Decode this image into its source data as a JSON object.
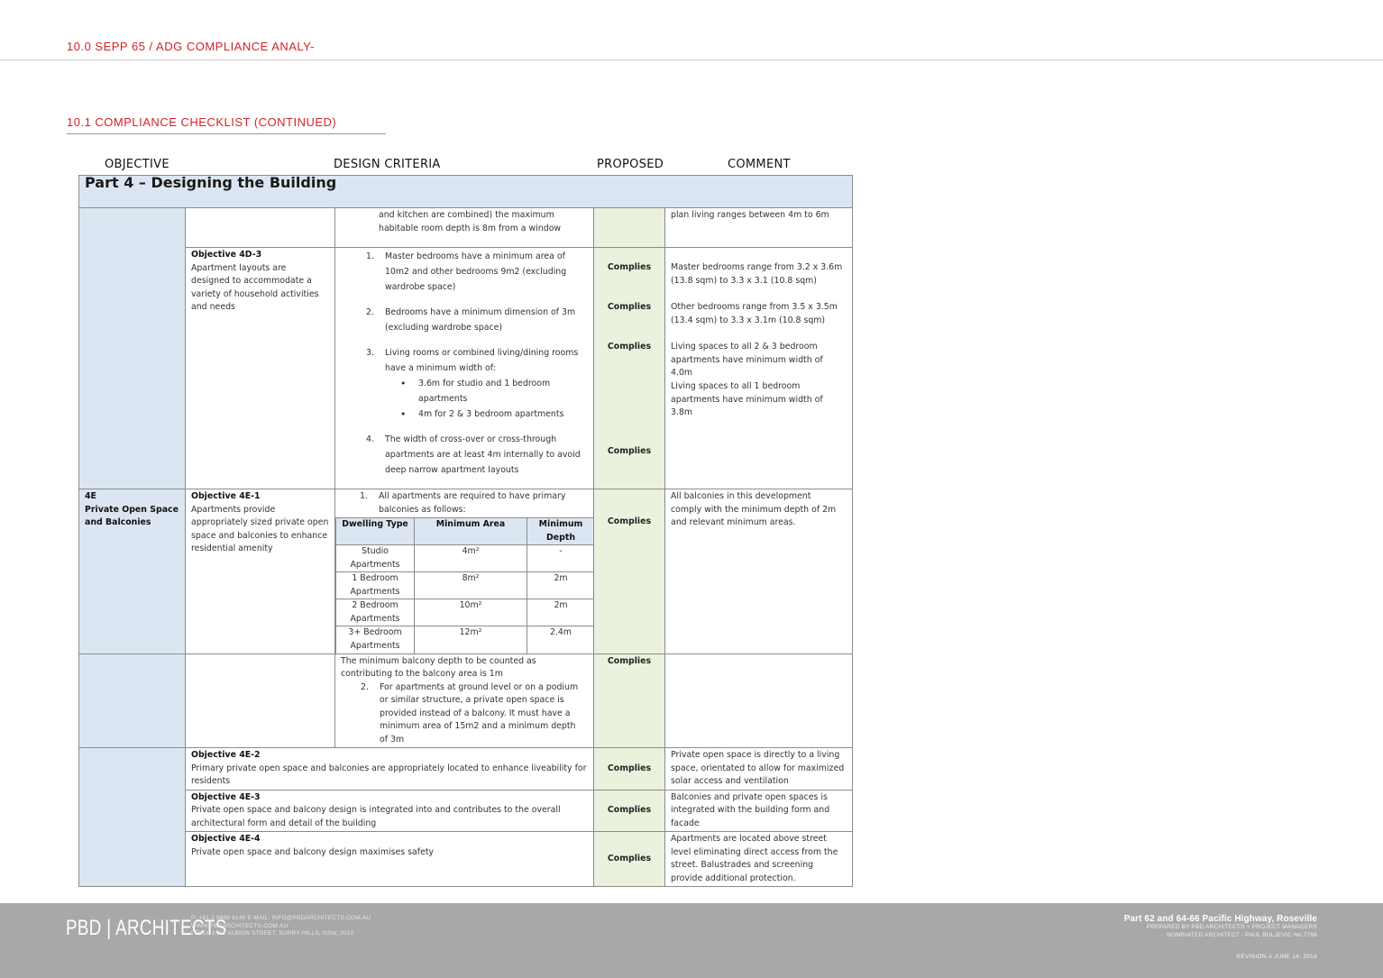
{
  "header": {
    "title": "10.0 SEPP 65 / ADG COMPLIANCE ANALY-"
  },
  "section": {
    "title": "10.1 COMPLIANCE CHECKLIST (CONTINUED)"
  },
  "columns": {
    "objective": "OBJECTIVE",
    "design_criteria": "DESIGN CRITERIA",
    "proposed": "PROPOSED",
    "comment": "COMMENT"
  },
  "part": {
    "title": "Part 4 – Designing the Building"
  },
  "rows": {
    "cont": {
      "criteria": "and kitchen are combined) the maximum habitable room depth is 8m from a window",
      "comment": "plan living ranges between 4m to 6m"
    },
    "o4d3": {
      "title": "Objective 4D-3",
      "desc": "Apartment layouts are designed to accommodate a variety of household activities and needs",
      "items": [
        {
          "num": "1.",
          "text": "Master bedrooms have a minimum area of 10m2 and other bedrooms 9m2 (excluding wardrobe space)",
          "proposed": "Complies",
          "comment": "Master bedrooms range from 3.2 x 3.6m (13.8 sqm) to 3.3 x 3.1 (10.8 sqm)"
        },
        {
          "num": "2.",
          "text": "Bedrooms have a minimum dimension of 3m (excluding wardrobe space)",
          "proposed": "Complies",
          "comment": "Other bedrooms range from 3.5 x 3.5m (13.4 sqm) to 3.3 x 3.1m (10.8 sqm)"
        },
        {
          "num": "3.",
          "text": "Living rooms or combined living/dining rooms have a minimum width of:",
          "sub": [
            "3.6m for studio and 1 bedroom apartments",
            "4m for 2 & 3 bedroom apartments"
          ],
          "proposed": "Complies",
          "comment": "Living spaces to all 2 & 3 bedroom apartments have minimum width of 4.0m",
          "comment2": "Living spaces to all 1 bedroom apartments have minimum width of 3.8m"
        },
        {
          "num": "4.",
          "text": "The width of cross-over or cross-through apartments are at least 4m internally to avoid deep narrow apartment layouts",
          "proposed": "Complies"
        }
      ]
    },
    "s4e": {
      "code": "4E",
      "title": "Private Open Space and Balconies"
    },
    "o4e1": {
      "title": "Objective 4E-1",
      "desc": "Apartments provide appropriately sized private open space and balconies to enhance residential amenity",
      "item1_num": "1.",
      "item1": "All apartments are required to have primary balconies as follows:",
      "proposed": "Complies",
      "comment": "All balconies in this development comply with the minimum depth of 2m and relevant minimum areas.",
      "table": {
        "headers": [
          "Dwelling Type",
          "Minimum Area",
          "Minimum Depth"
        ],
        "rows": [
          {
            "type": "Studio Apartments",
            "area": "4m²",
            "depth": "-"
          },
          {
            "type": "1 Bedroom Apartments",
            "area": "8m²",
            "depth": "2m"
          },
          {
            "type": "2 Bedroom Apartments",
            "area": "10m²",
            "depth": "2m"
          },
          {
            "type": "3+ Bedroom Apartments",
            "area": "12m²",
            "depth": "2.4m"
          }
        ]
      }
    },
    "o4e1b": {
      "para": "The minimum balcony depth to be counted as contributing to the balcony area is 1m",
      "item2_num": "2.",
      "item2": "For apartments at ground level or on a podium or similar structure, a private open space is provided instead of a balcony. It must have a minimum area of 15m2 and a minimum depth of 3m",
      "proposed": "Complies"
    },
    "o4e2": {
      "title": "Objective 4E-2",
      "desc": "Primary private open space and balconies are appropriately located to enhance liveability for residents",
      "proposed": "Complies",
      "comment": "Private open space is directly to a living space, orientated to allow for maximized solar access and ventilation"
    },
    "o4e3": {
      "title": "Objective 4E-3",
      "desc": "Private open space and balcony design is integrated into and contributes to the overall architectural form and detail of the building",
      "proposed": "Complies",
      "comment": "Balconies and private open spaces is integrated with the building form and facade"
    },
    "o4e4": {
      "title": "Objective 4E-4",
      "desc": "Private open space and balcony design maximises safety",
      "proposed": "Complies",
      "comment": "Apartments are located above street level eliminating direct access from the street. Balustrades and screening provide additional protection."
    }
  },
  "footer": {
    "logo": "PBD | ARCHITECTS",
    "contact": [
      "P: +61 2 9698 8140    E-MAIL: INFO@PBDARCHITECTS.COM.AU",
      "WWW.PBDARCHITECTS.COM.AU",
      "LEVEL 2, 52 ALBION STREET, SURRY HILLS, NSW, 2010"
    ],
    "project_title": "Part 62 and 64-66 Pacific Highway, Roseville",
    "project_lines": [
      "PREPARED BY PBD ARCHITECTS + PROJECT MANAGERS",
      "NOMINATED ARCHITECT - PAUL BULJEVIC  No.7768"
    ],
    "revision": "REVISION A    JUNE 14, 2018"
  },
  "colors": {
    "accent": "#d2232a",
    "objective_bg": "#dce6f2",
    "proposed_bg": "#eaf1dd",
    "footer_bg": "#a7a8aa"
  }
}
